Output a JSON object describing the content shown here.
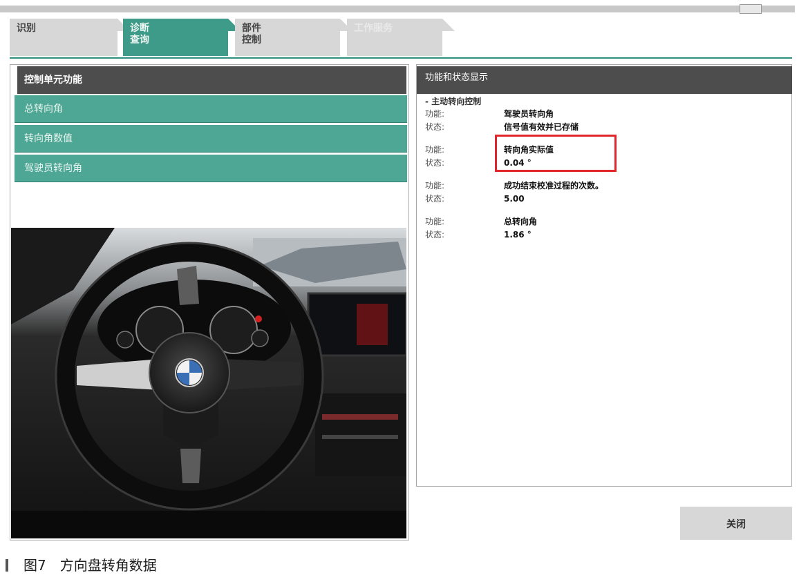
{
  "tabs": [
    {
      "label1": "识别",
      "label2": ""
    },
    {
      "label1": "诊断",
      "label2": "查询"
    },
    {
      "label1": "部件",
      "label2": "控制"
    },
    {
      "label1": "工作服务",
      "label2": ""
    }
  ],
  "left_panel": {
    "header": "控制单元功能",
    "items": [
      "总转向角",
      "转向角数值",
      "驾驶员转向角"
    ]
  },
  "right_panel": {
    "header": "功能和状态显示",
    "group_title": "- 主动转向控制",
    "function_label": "功能:",
    "status_label": "状态:",
    "entries": [
      {
        "function": "驾驶员转向角",
        "status": "信号值有效并已存储"
      },
      {
        "function": "转向角实际值",
        "status": "0.04 °"
      },
      {
        "function": "成功结束校准过程的次数。",
        "status": "5.00"
      },
      {
        "function": "总转向角",
        "status": "1.86 °"
      }
    ]
  },
  "close_button": "关闭",
  "caption": "图7　方向盘转角数据",
  "colors": {
    "tab_active": "#3f9b89",
    "row_teal": "#4ea795",
    "header_dark": "#4d4d4d",
    "highlight": "#e0262b"
  }
}
